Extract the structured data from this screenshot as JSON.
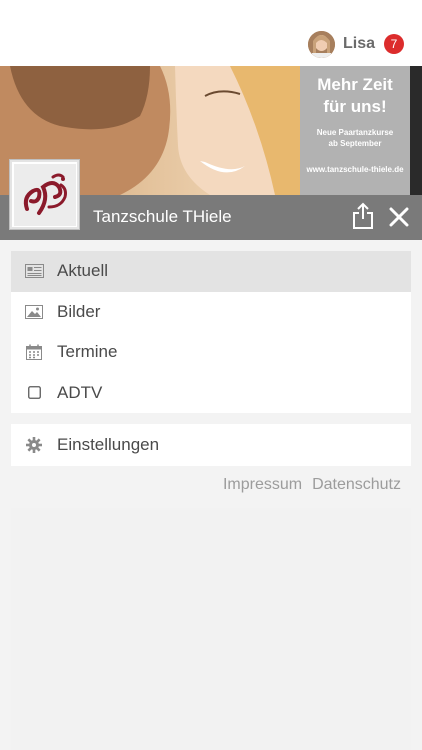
{
  "user": {
    "name": "Lisa",
    "notification_count": "7"
  },
  "banner": {
    "headline": "Mehr Zeit\nfür uns!",
    "subline": "Neue Paartanzkurse\nab September",
    "url": "www.tanzschule-thiele.de"
  },
  "header": {
    "title": "Tanzschule THiele"
  },
  "menu": {
    "items": [
      {
        "label": "Aktuell",
        "icon": "newspaper-icon",
        "active": true
      },
      {
        "label": "Bilder",
        "icon": "image-icon",
        "active": false
      },
      {
        "label": "Termine",
        "icon": "calendar-icon",
        "active": false
      },
      {
        "label": "ADTV",
        "icon": "square-icon",
        "active": false
      }
    ]
  },
  "settings": {
    "label": "Einstellungen",
    "icon": "gear-icon"
  },
  "footer": {
    "impressum": "Impressum",
    "datenschutz": "Datenschutz"
  },
  "colors": {
    "badge": "#dc2c2c",
    "titlebar": "#7a7a7a",
    "logo": "#8b1a2b",
    "active_item": "#e3e3e3"
  }
}
